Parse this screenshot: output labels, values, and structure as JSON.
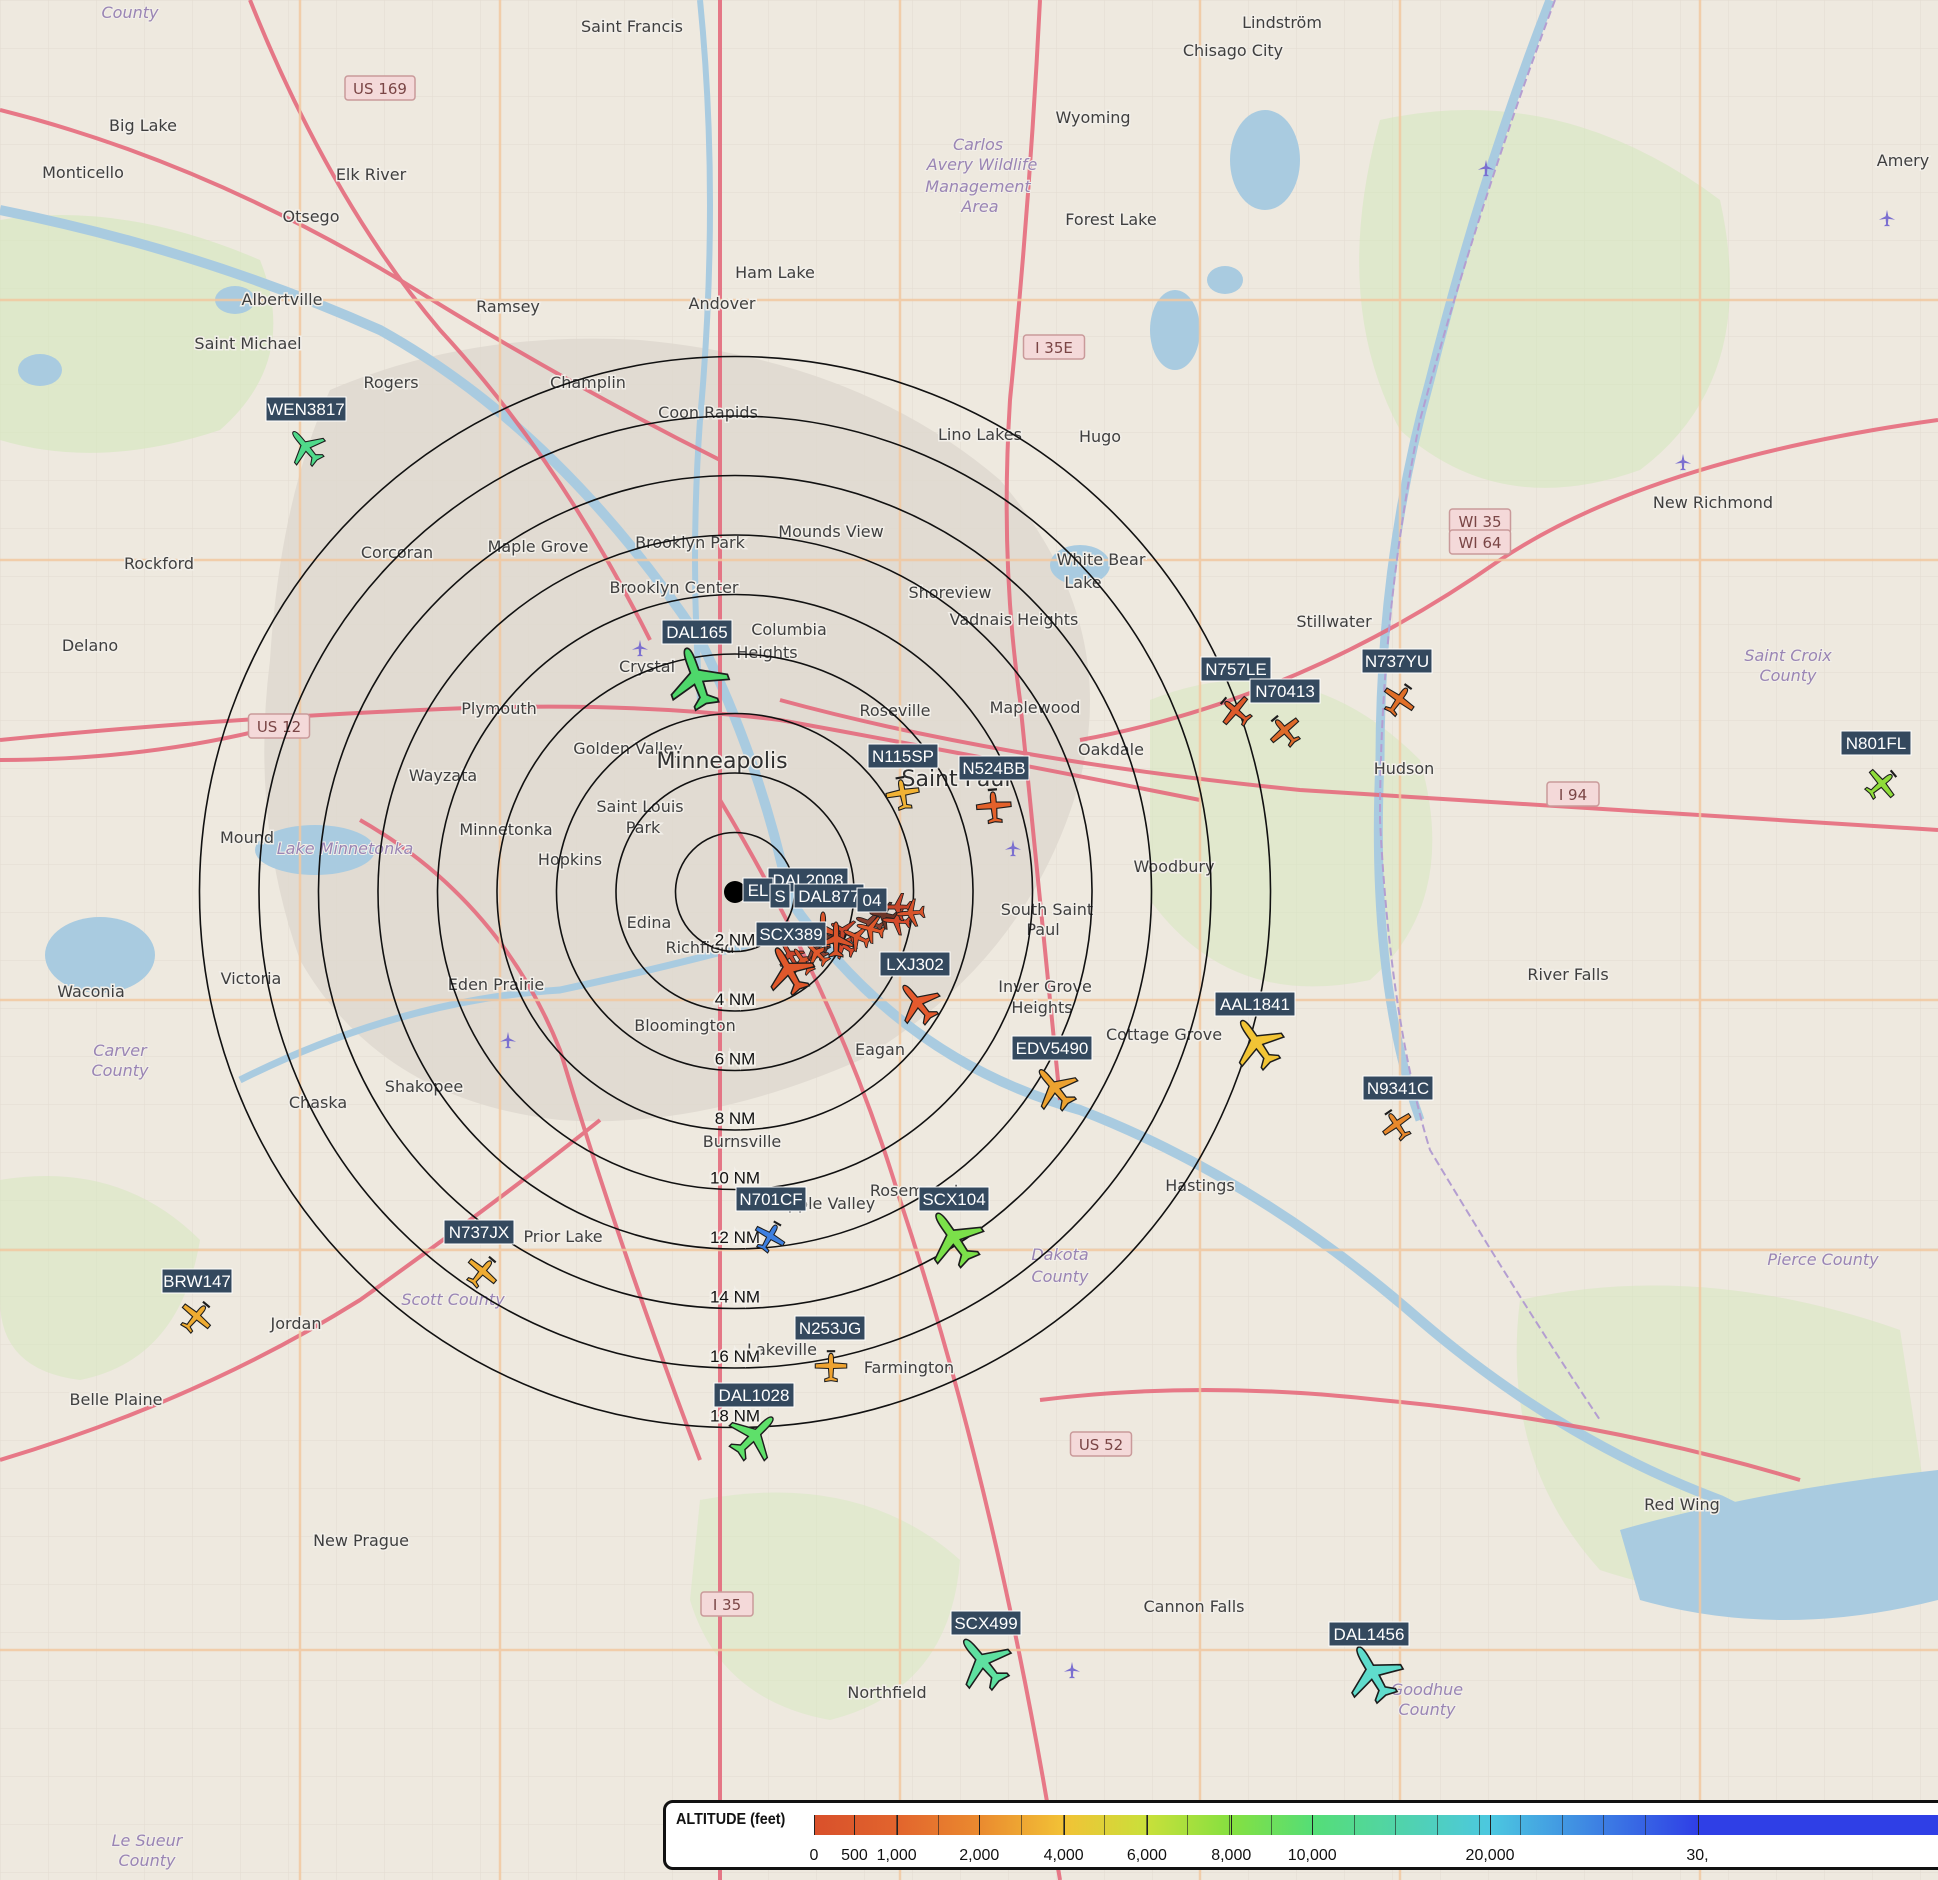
{
  "places": [
    {
      "name": "Saint Francis",
      "type": "town"
    },
    {
      "name": "Lindström",
      "type": "town"
    },
    {
      "name": "Chisago City",
      "type": "town"
    },
    {
      "name": "Big Lake",
      "type": "town"
    },
    {
      "name": "Monticello",
      "type": "town"
    },
    {
      "name": "Elk River",
      "type": "town"
    },
    {
      "name": "Wyoming",
      "type": "town"
    },
    {
      "name": "Amery",
      "type": "town"
    },
    {
      "name": "Otsego",
      "type": "town"
    },
    {
      "name": "Forest Lake",
      "type": "town"
    },
    {
      "name": "Ham Lake",
      "type": "town"
    },
    {
      "name": "Albertville",
      "type": "town"
    },
    {
      "name": "Andover",
      "type": "town"
    },
    {
      "name": "Ramsey",
      "type": "town"
    },
    {
      "name": "Saint Michael",
      "type": "town"
    },
    {
      "name": "Champlin",
      "type": "town"
    },
    {
      "name": "Rogers",
      "type": "town"
    },
    {
      "name": "Coon Rapids",
      "type": "town"
    },
    {
      "name": "Lino Lakes",
      "type": "town"
    },
    {
      "name": "Hugo",
      "type": "town"
    },
    {
      "name": "New Richmond",
      "type": "town"
    },
    {
      "name": "Maple Grove",
      "type": "town"
    },
    {
      "name": "Brooklyn Park",
      "type": "town"
    },
    {
      "name": "Mounds View",
      "type": "town"
    },
    {
      "name": "Corcoran",
      "type": "town"
    },
    {
      "name": "Rockford",
      "type": "town"
    },
    {
      "name": "White Bear",
      "type": "town"
    },
    {
      "name": "Lake",
      "type": "town"
    },
    {
      "name": "Shoreview",
      "type": "town"
    },
    {
      "name": "Brooklyn Center",
      "type": "town"
    },
    {
      "name": "Vadnais Heights",
      "type": "town"
    },
    {
      "name": "Stillwater",
      "type": "town"
    },
    {
      "name": "Delano",
      "type": "town"
    },
    {
      "name": "Columbia",
      "type": "town"
    },
    {
      "name": "Heights",
      "type": "town"
    },
    {
      "name": "Crystal",
      "type": "town"
    },
    {
      "name": "Plymouth",
      "type": "town"
    },
    {
      "name": "Roseville",
      "type": "town"
    },
    {
      "name": "Maplewood",
      "type": "town"
    },
    {
      "name": "Golden Valley",
      "type": "town"
    },
    {
      "name": "Oakdale",
      "type": "town"
    },
    {
      "name": "Hudson",
      "type": "town"
    },
    {
      "name": "Minneapolis",
      "type": "city"
    },
    {
      "name": "Wayzata",
      "type": "town"
    },
    {
      "name": "Saint Paul",
      "type": "city"
    },
    {
      "name": "Saint Louis",
      "type": "town"
    },
    {
      "name": "Park",
      "type": "town"
    },
    {
      "name": "Minnetonka",
      "type": "town"
    },
    {
      "name": "Mound",
      "type": "town"
    },
    {
      "name": "Hopkins",
      "type": "town"
    },
    {
      "name": "Woodbury",
      "type": "town"
    },
    {
      "name": "Edina",
      "type": "town"
    },
    {
      "name": "South Saint",
      "type": "town"
    },
    {
      "name": "Paul",
      "type": "town"
    },
    {
      "name": "Richfield",
      "type": "town"
    },
    {
      "name": "River Falls",
      "type": "town"
    },
    {
      "name": "Victoria",
      "type": "town"
    },
    {
      "name": "Waconia",
      "type": "town"
    },
    {
      "name": "Eden Prairie",
      "type": "town"
    },
    {
      "name": "Inver Grove",
      "type": "town"
    },
    {
      "name": "Heights",
      "type": "town"
    },
    {
      "name": "Bloomington",
      "type": "town"
    },
    {
      "name": "Cottage Grove",
      "type": "town"
    },
    {
      "name": "Eagan",
      "type": "town"
    },
    {
      "name": "Chaska",
      "type": "town"
    },
    {
      "name": "Shakopee",
      "type": "town"
    },
    {
      "name": "Burnsville",
      "type": "town"
    },
    {
      "name": "Hastings",
      "type": "town"
    },
    {
      "name": "Apple Valley",
      "type": "town"
    },
    {
      "name": "Rosemount",
      "type": "town"
    },
    {
      "name": "Prior Lake",
      "type": "town"
    },
    {
      "name": "Jordan",
      "type": "town"
    },
    {
      "name": "Lakeville",
      "type": "town"
    },
    {
      "name": "Farmington",
      "type": "town"
    },
    {
      "name": "Belle Plaine",
      "type": "town"
    },
    {
      "name": "Red Wing",
      "type": "town"
    },
    {
      "name": "New Prague",
      "type": "town"
    },
    {
      "name": "Cannon Falls",
      "type": "town"
    },
    {
      "name": "Northfield",
      "type": "town"
    },
    {
      "name": "Lake Minnetonka",
      "type": "water"
    }
  ],
  "counties": [
    "County",
    "Carlos",
    "Avery Wildlife",
    "Management",
    "Area",
    "Saint Croix",
    "County",
    "Carver",
    "County",
    "Dakota",
    "County",
    "Pierce County",
    "Scott County",
    "Goodhue",
    "County",
    "Le Sueur",
    "County"
  ],
  "shields": [
    "US 169",
    "I 35E",
    "WI 35",
    "WI 64",
    "US 12",
    "I 94",
    "US 52",
    "I 35"
  ],
  "range_rings": {
    "unit": "NM",
    "labels": [
      "2 NM",
      "4 NM",
      "6 NM",
      "8 NM",
      "10 NM",
      "12 NM",
      "14 NM",
      "16 NM",
      "18 NM"
    ]
  },
  "aircraft": [
    {
      "callsign": "WEN3817",
      "color": "#4fd98a",
      "type": "jet"
    },
    {
      "callsign": "DAL165",
      "color": "#4ed86b",
      "type": "jet"
    },
    {
      "callsign": "N757LE",
      "color": "#dd5a2a",
      "type": "prop"
    },
    {
      "callsign": "N70413",
      "color": "#dd6a2a",
      "type": "prop"
    },
    {
      "callsign": "N737YU",
      "color": "#e06f28",
      "type": "prop"
    },
    {
      "callsign": "N801FL",
      "color": "#8fdc3a",
      "type": "prop"
    },
    {
      "callsign": "N115SP",
      "color": "#f1b234",
      "type": "prop"
    },
    {
      "callsign": "N524BB",
      "color": "#e3612b",
      "type": "prop"
    },
    {
      "callsign": "DAL2008",
      "color": "#d9542b",
      "type": "jet"
    },
    {
      "callsign": "DAL877",
      "color": "#d9542b",
      "type": "jet"
    },
    {
      "callsign": "SCX389",
      "color": "#e0582b",
      "type": "jet"
    },
    {
      "callsign": "LXJ302",
      "color": "#e45a2d",
      "type": "jet"
    },
    {
      "callsign": "AAL1841",
      "color": "#f2c435",
      "type": "jet"
    },
    {
      "callsign": "EDV5490",
      "color": "#eda230",
      "type": "jet"
    },
    {
      "callsign": "N9341C",
      "color": "#e8882b",
      "type": "prop"
    },
    {
      "callsign": "N701CF",
      "color": "#3d7fe0",
      "type": "prop"
    },
    {
      "callsign": "SCX104",
      "color": "#7be04a",
      "type": "jet"
    },
    {
      "callsign": "N737JX",
      "color": "#eeab31",
      "type": "prop"
    },
    {
      "callsign": "BRW147",
      "color": "#eeab31",
      "type": "prop"
    },
    {
      "callsign": "N253JG",
      "color": "#eea331",
      "type": "prop"
    },
    {
      "callsign": "DAL1028",
      "color": "#5ee06a",
      "type": "jet"
    },
    {
      "callsign": "SCX499",
      "color": "#5ee0a0",
      "type": "jet"
    },
    {
      "callsign": "DAL1456",
      "color": "#5fdccc",
      "type": "jet"
    }
  ],
  "cluster_tags": [
    "EL",
    "DAL2008",
    "S",
    "DAL877",
    "04",
    "SCX389"
  ],
  "legend": {
    "title": "ALTITUDE (feet)",
    "stops": [
      {
        "alt": 0,
        "label": "0",
        "color": "#d9502b"
      },
      {
        "alt": 500,
        "label": "500",
        "color": "#dc5a2c"
      },
      {
        "alt": 1000,
        "label": "1,000",
        "color": "#e2642d"
      },
      {
        "alt": 2000,
        "label": "2,000",
        "color": "#ea8a2f"
      },
      {
        "alt": 4000,
        "label": "4,000",
        "color": "#f2c236"
      },
      {
        "alt": 6000,
        "label": "6,000",
        "color": "#c9e03a"
      },
      {
        "alt": 8000,
        "label": "8,000",
        "color": "#85e040"
      },
      {
        "alt": 10000,
        "label": "10,000",
        "color": "#55de76"
      },
      {
        "alt": 20000,
        "label": "20,000",
        "color": "#4cc8e0"
      },
      {
        "alt": 30000,
        "label": "30,",
        "color": "#2f3fe6"
      }
    ]
  },
  "colors": {
    "land": "#eee9df",
    "water": "#a9cbe0",
    "park": "#cfe6b5",
    "urban": "#dcd6cc",
    "primary_road": "#e56b7d",
    "secondary_road": "#f1c8a0",
    "tag_bg": "#34495e"
  }
}
